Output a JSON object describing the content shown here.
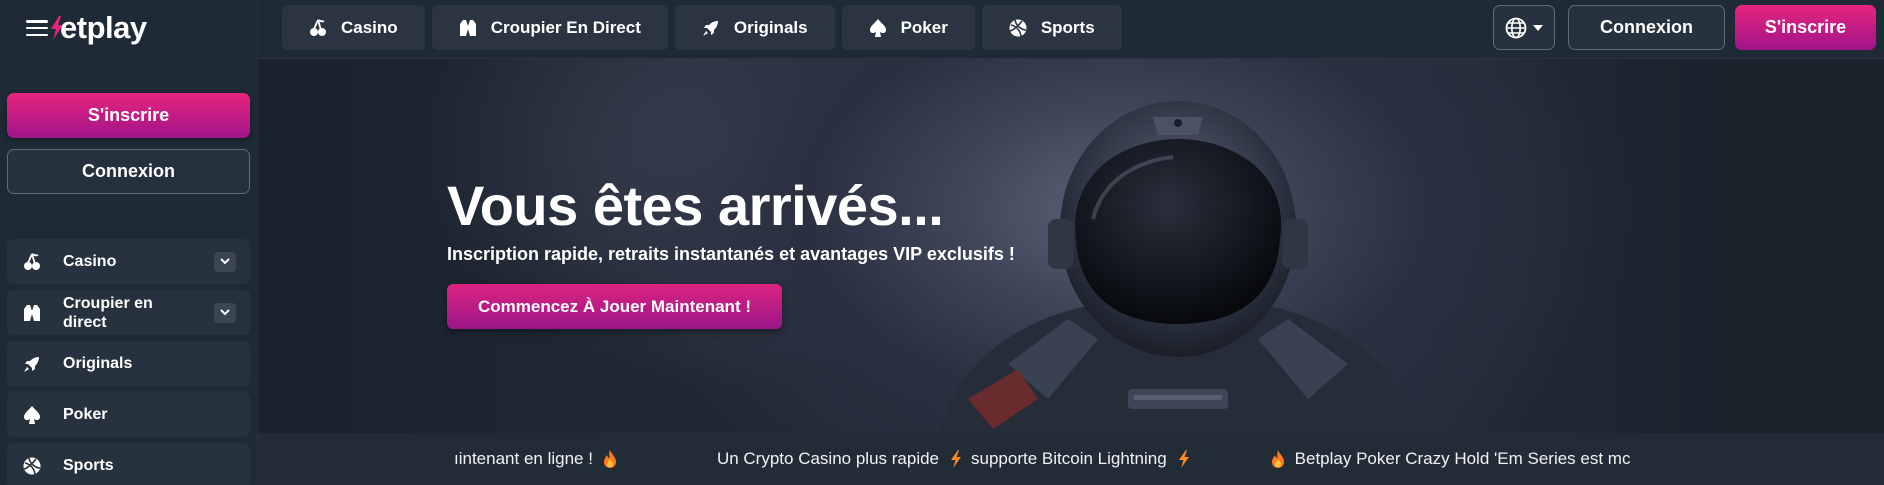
{
  "brand": {
    "name": "Betplay",
    "name_rest": "etplay"
  },
  "sidebar": {
    "signup_label": "S'inscrire",
    "login_label": "Connexion",
    "items": [
      {
        "label": "Casino",
        "icon": "cherries-icon",
        "expandable": true
      },
      {
        "label": "Croupier en direct",
        "icon": "dealer-vest-icon",
        "expandable": true
      },
      {
        "label": "Originals",
        "icon": "rocket-icon",
        "expandable": false
      },
      {
        "label": "Poker",
        "icon": "spade-icon",
        "expandable": false
      },
      {
        "label": "Sports",
        "icon": "sports-ball-icon",
        "expandable": false
      }
    ]
  },
  "topbar": {
    "tabs": [
      {
        "label": "Casino",
        "icon": "cherries-icon"
      },
      {
        "label": "Croupier En Direct",
        "icon": "dealer-vest-icon"
      },
      {
        "label": "Originals",
        "icon": "rocket-icon"
      },
      {
        "label": "Poker",
        "icon": "spade-icon"
      },
      {
        "label": "Sports",
        "icon": "sports-ball-icon"
      }
    ],
    "language_icon": "globe-icon",
    "login_label": "Connexion",
    "signup_label": "S'inscrire"
  },
  "hero": {
    "title": "Vous êtes arrivés...",
    "subtitle": "Inscription rapide, retraits instantanés et avantages VIP exclusifs !",
    "cta_label": "Commencez À Jouer Maintenant !"
  },
  "ticker": {
    "items": [
      {
        "text": "ıintenant en ligne !",
        "icon": "fire-icon",
        "icon_side": "after"
      },
      {
        "text": "Un Crypto Casino plus rapide",
        "icon": "lightning-icon",
        "icon_side": "after"
      },
      {
        "text": "supporte Bitcoin Lightning",
        "icon": "lightning-icon",
        "icon_side": "after"
      },
      {
        "text": "Betplay Poker Crazy Hold 'Em Series est mc",
        "icon": "fire-icon",
        "icon_side": "before"
      }
    ]
  },
  "colors": {
    "accent_pink": "#e8247e",
    "accent_purple": "#a1148a",
    "sidebar_bg": "#1e2a35",
    "item_bg": "#26323e"
  }
}
